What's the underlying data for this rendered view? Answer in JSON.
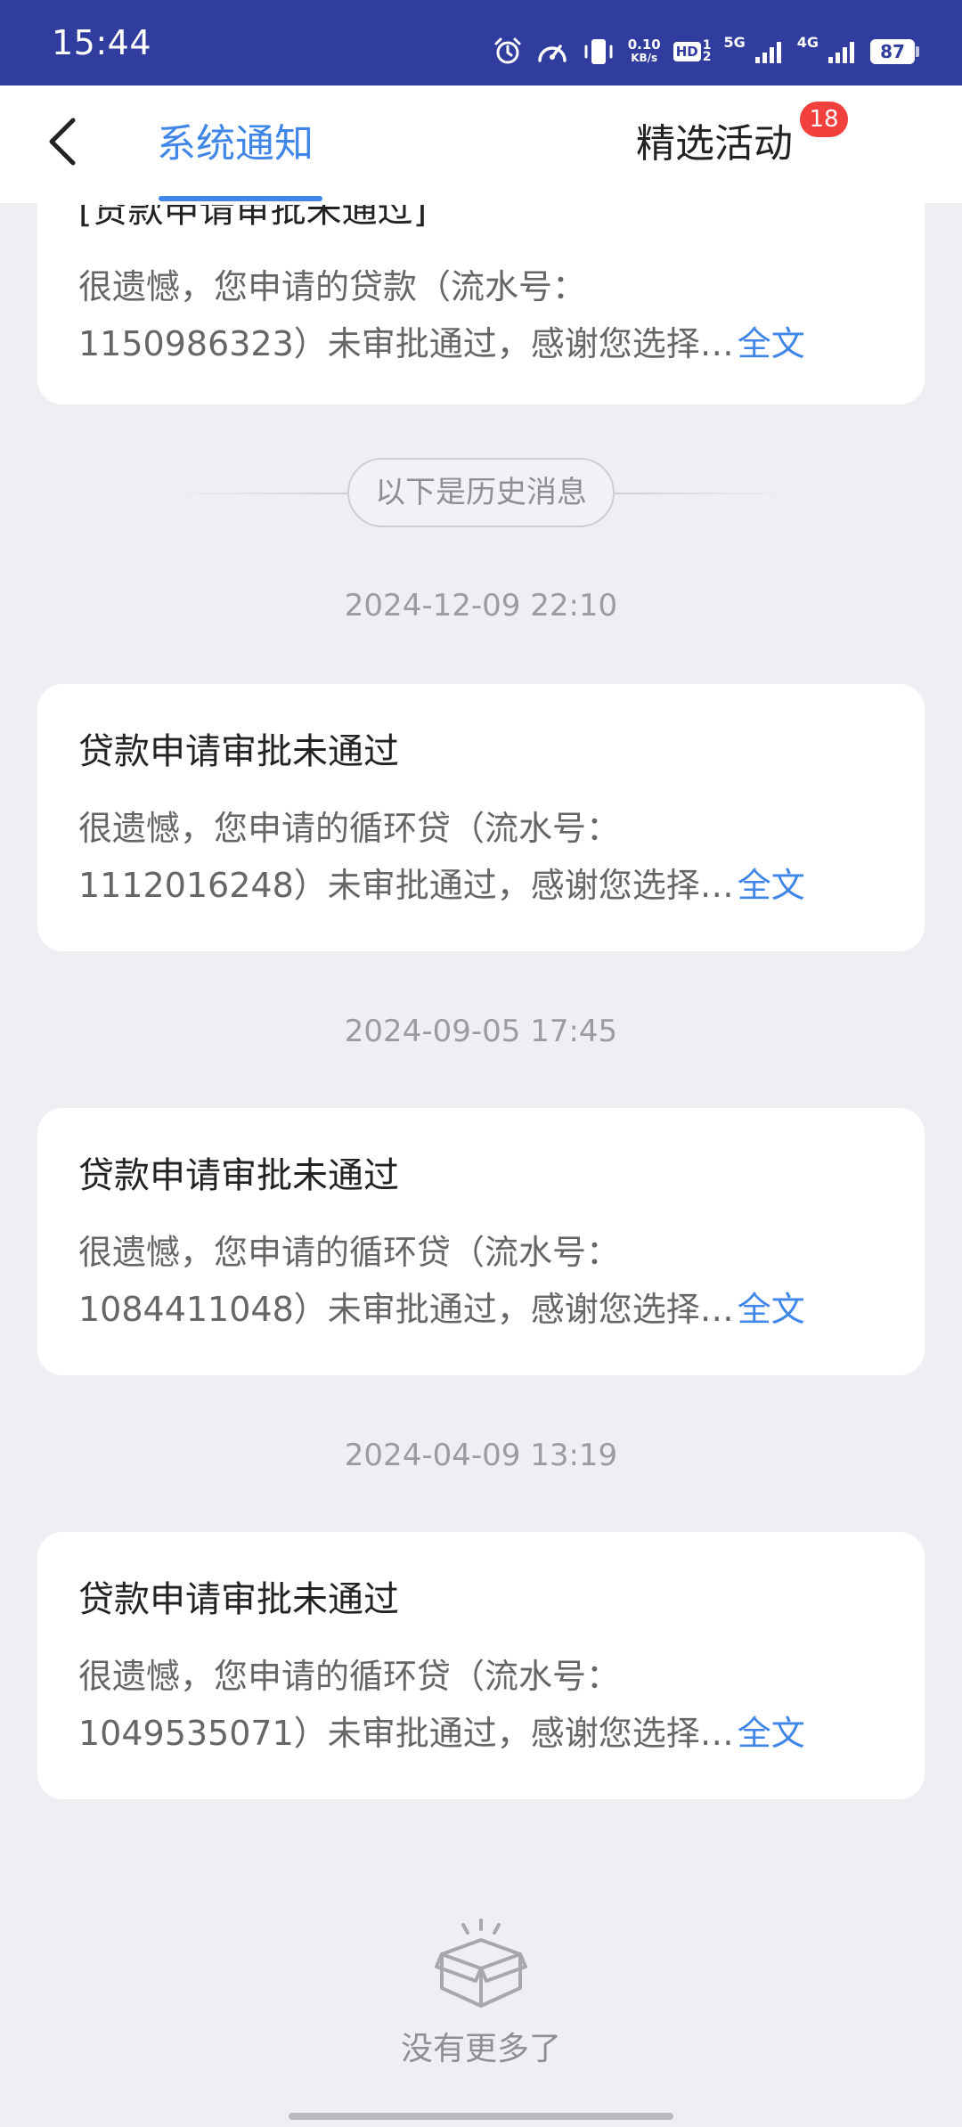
{
  "status_bar": {
    "time": "15:44",
    "net_speed_value": "0.10",
    "net_speed_unit": "KB/s",
    "hd_label": "HD",
    "hd_sub_top": "1",
    "hd_sub_bottom": "2",
    "signal1_label": "5G",
    "signal2_label": "4G",
    "battery_level": "87"
  },
  "header": {
    "tabs": [
      {
        "label": "系统通知",
        "active": true
      },
      {
        "label": "精选活动",
        "badge": "18"
      }
    ]
  },
  "messages_top": {
    "cut_title": "[贷款申请审批未通过]",
    "line1": "很遗憾，您申请的贷款（流水号：",
    "line2": "1150986323）未审批通过，感谢您选择…",
    "link": "全文"
  },
  "history_divider": "以下是历史消息",
  "messages": [
    {
      "timestamp": "2024-12-09 22:10",
      "title": "贷款申请审批未通过",
      "line1": "很遗憾，您申请的循环贷（流水号：",
      "line2": "1112016248）未审批通过，感谢您选择…",
      "link": "全文"
    },
    {
      "timestamp": "2024-09-05 17:45",
      "title": "贷款申请审批未通过",
      "line1": "很遗憾，您申请的循环贷（流水号：",
      "line2": "1084411048）未审批通过，感谢您选择…",
      "link": "全文"
    },
    {
      "timestamp": "2024-04-09 13:19",
      "title": "贷款申请审批未通过",
      "line1": "很遗憾，您申请的循环贷（流水号：",
      "line2": "1049535071）未审批通过，感谢您选择…",
      "link": "全文"
    }
  ],
  "footer": {
    "no_more_text": "没有更多了"
  },
  "colors": {
    "status_bar_bg": "#303C9E",
    "accent": "#3F86E8",
    "badge": "#F2403C",
    "page_bg": "#EEEEF3"
  },
  "icons": [
    "alarm-icon",
    "speedometer-icon",
    "vibrate-icon",
    "signal-icon",
    "battery-icon",
    "back-arrow-icon",
    "empty-box-icon"
  ]
}
